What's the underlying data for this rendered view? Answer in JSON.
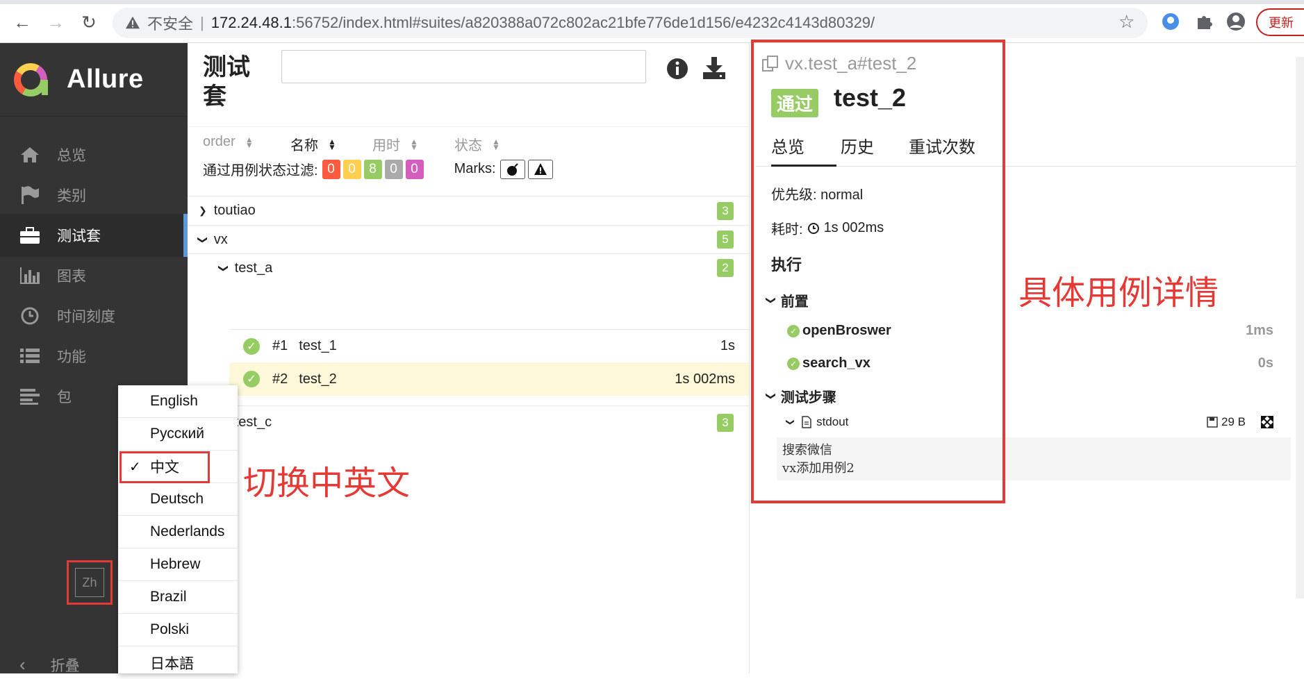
{
  "browser": {
    "insecure_label": "不安全",
    "url_host": "172.24.48.1",
    "url_rest": ":56752/index.html#suites/a820388a072c802ac21bfe776de1d156/e4232c4143d80329/",
    "update_label": "更新"
  },
  "sidebar": {
    "brand": "Allure",
    "items": [
      {
        "label": "总览",
        "icon": "home-icon"
      },
      {
        "label": "类别",
        "icon": "flag-icon"
      },
      {
        "label": "测试套",
        "icon": "briefcase-icon",
        "active": true
      },
      {
        "label": "图表",
        "icon": "bar-chart-icon"
      },
      {
        "label": "时间刻度",
        "icon": "clock-icon"
      },
      {
        "label": "功能",
        "icon": "list-icon"
      },
      {
        "label": "包",
        "icon": "align-left-icon"
      }
    ],
    "lang_button": "Zh",
    "collapse_label": "折叠"
  },
  "language_menu": {
    "items": [
      "English",
      "Русский",
      "中文",
      "Deutsch",
      "Nederlands",
      "Hebrew",
      "Brazil",
      "Polski",
      "日本語"
    ],
    "selected": "中文"
  },
  "main": {
    "title": "测试套",
    "sort": [
      {
        "label": "order"
      },
      {
        "label": "名称",
        "active": true
      },
      {
        "label": "用时"
      },
      {
        "label": "状态"
      }
    ],
    "filter_label": "通过用例状态过滤:",
    "counts": [
      {
        "value": "0",
        "color": "#fd5a3e"
      },
      {
        "value": "0",
        "color": "#ffd050"
      },
      {
        "value": "8",
        "color": "#97cc64"
      },
      {
        "value": "0",
        "color": "#aaaaaa"
      },
      {
        "value": "0",
        "color": "#d35ebe"
      }
    ],
    "marks_label": "Marks:",
    "tree": {
      "toutiao": {
        "name": "toutiao",
        "count": "3"
      },
      "vx": {
        "name": "vx",
        "count": "5"
      },
      "test_a": {
        "name": "test_a",
        "count": "2"
      },
      "test_1": {
        "num": "#1",
        "name": "test_1",
        "duration": "1s"
      },
      "test_2": {
        "num": "#2",
        "name": "test_2",
        "duration": "1s 002ms"
      },
      "test_c": {
        "name": "test_c",
        "count": "3"
      }
    }
  },
  "detail": {
    "path": "vx.test_a#test_2",
    "status": "通过",
    "title": "test_2",
    "tabs": [
      "总览",
      "历史",
      "重试次数"
    ],
    "priority": "优先级: normal",
    "duration_label": "耗时:",
    "duration": "1s 002ms",
    "execution_title": "执行",
    "setup_title": "前置",
    "fixtures": [
      {
        "name": "openBroswer",
        "duration": "1ms"
      },
      {
        "name": "search_vx",
        "duration": "0s"
      }
    ],
    "steps_title": "测试步骤",
    "stdout_name": "stdout",
    "stdout_size": "29 B",
    "stdout_lines": [
      "搜索微信",
      "vx添加用例2"
    ]
  },
  "annotations": {
    "detail": "具体用例详情",
    "language": "切换中英文"
  }
}
